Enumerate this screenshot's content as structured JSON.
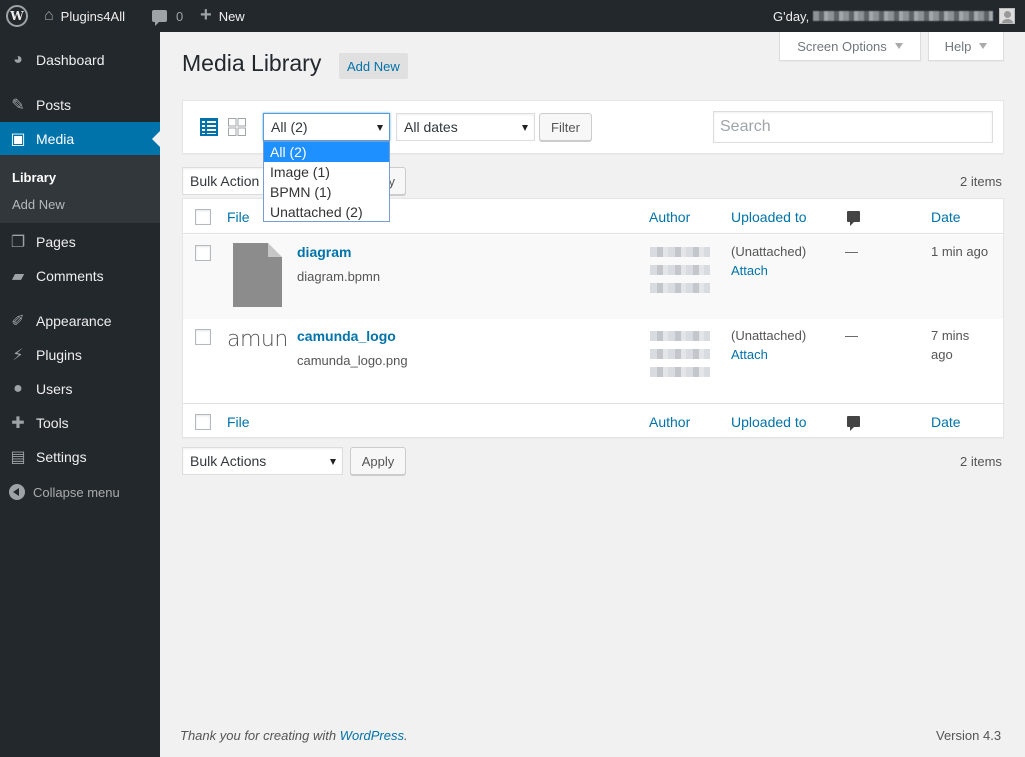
{
  "adminbar": {
    "site_name": "Plugins4All",
    "comments_count": "0",
    "new_label": "New",
    "greeting": "G'day,"
  },
  "sidebar": {
    "items": [
      {
        "label": "Dashboard",
        "icon": "dashboard-icon"
      },
      {
        "label": "Posts",
        "icon": "pushpin-icon"
      },
      {
        "label": "Media",
        "icon": "media-icon"
      },
      {
        "label": "Pages",
        "icon": "pages-icon"
      },
      {
        "label": "Comments",
        "icon": "comments-icon"
      },
      {
        "label": "Appearance",
        "icon": "brush-icon"
      },
      {
        "label": "Plugins",
        "icon": "plug-icon"
      },
      {
        "label": "Users",
        "icon": "user-icon"
      },
      {
        "label": "Tools",
        "icon": "wrench-icon"
      },
      {
        "label": "Settings",
        "icon": "settings-icon"
      }
    ],
    "submenu": [
      "Library",
      "Add New"
    ],
    "collapse_label": "Collapse menu"
  },
  "header": {
    "screen_options": "Screen Options",
    "help": "Help",
    "title": "Media Library",
    "add_new": "Add New"
  },
  "toolbar": {
    "type_filter_value": "All (2)",
    "type_filter_options": [
      "All (2)",
      "Image (1)",
      "BPMN (1)",
      "Unattached (2)"
    ],
    "date_filter_value": "All dates",
    "filter_button": "Filter",
    "search_placeholder": "Search"
  },
  "bulk": {
    "label": "Bulk Actions",
    "apply": "Apply",
    "apply_partial": "y",
    "top_label_partial": "Bulk Action"
  },
  "items_count": "2 items",
  "table": {
    "columns": {
      "file": "File",
      "author": "Author",
      "uploaded_to": "Uploaded to",
      "date": "Date"
    },
    "rows": [
      {
        "title": "diagram",
        "filename": "diagram.bpmn",
        "uploaded": "(Unattached)",
        "attach": "Attach",
        "comments": "—",
        "date": "1 min ago"
      },
      {
        "title": "camunda_logo",
        "filename": "camunda_logo.png",
        "uploaded": "(Unattached)",
        "attach": "Attach",
        "comments": "—",
        "date_line1": "7 mins",
        "date_line2": "ago",
        "thumb_text": "amun"
      }
    ]
  },
  "footer": {
    "thanks_prefix": "Thank you for creating with",
    "thanks_link": "WordPress",
    "thanks_suffix": ".",
    "version": "Version 4.3"
  },
  "colors": {
    "adminbar": "#23282d",
    "menu_current": "#0073aa",
    "link": "#0073aa",
    "dropdown_selected": "#1e90ff"
  }
}
